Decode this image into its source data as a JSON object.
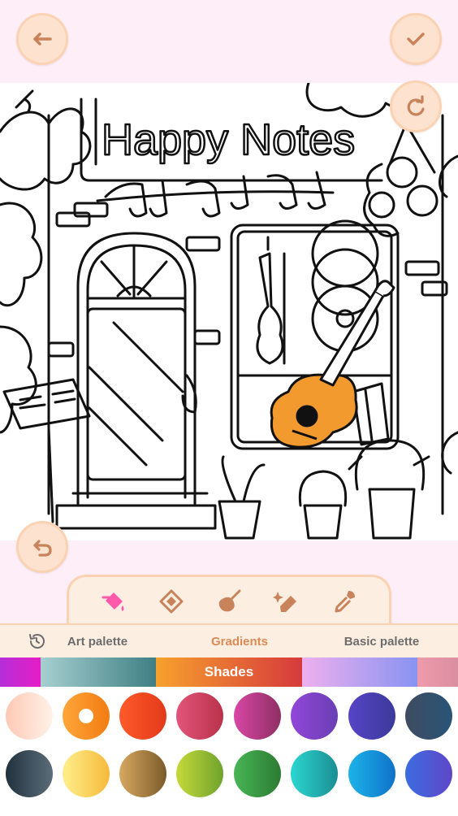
{
  "canvas_title": "Happy Notes",
  "toolbar": {
    "back_icon": "arrow-left-icon",
    "done_icon": "checkmark-icon",
    "reset_icon": "refresh-icon",
    "undo_icon": "undo-icon"
  },
  "tools": [
    {
      "name": "bucket-fill-tool",
      "icon": "paint-bucket-icon",
      "active": true
    },
    {
      "name": "pattern-fill-tool",
      "icon": "diamond-fill-icon",
      "active": false
    },
    {
      "name": "brush-tool",
      "icon": "brush-icon",
      "active": false
    },
    {
      "name": "eraser-tool",
      "icon": "magic-eraser-icon",
      "active": false
    },
    {
      "name": "eyedropper-tool",
      "icon": "eyedropper-icon",
      "active": false
    }
  ],
  "tabs": {
    "history_icon": "history-icon",
    "art": "Art palette",
    "gradients": "Gradients",
    "basic": "Basic palette",
    "active": "Gradients"
  },
  "strip": {
    "label": "Shades",
    "segments": [
      {
        "from": "#b52fd8",
        "to": "#e61dc5"
      },
      {
        "from": "#a7cfd0",
        "to": "#3e7f83"
      },
      {
        "from": "#f7a12d",
        "to": "#d63a3c"
      },
      {
        "from": "#eeb0ee",
        "to": "#8893f2"
      },
      {
        "from": "#ef9aaa",
        "to": "#d98fa0"
      }
    ]
  },
  "swatches": [
    {
      "from": "#ffc9b5",
      "to": "#fff1e8"
    },
    {
      "from": "#ffa63a",
      "to": "#f27c12",
      "selected": true
    },
    {
      "from": "#ff5a2a",
      "to": "#e23a1a"
    },
    {
      "from": "#e2557a",
      "to": "#b9324b"
    },
    {
      "from": "#d846a4",
      "to": "#8f2f63"
    },
    {
      "from": "#9146d9",
      "to": "#6a3fb4"
    },
    {
      "from": "#5644c6",
      "to": "#3b3a9b"
    },
    {
      "from": "#3e4c60",
      "to": "#2a5478"
    },
    {
      "from": "#22313e",
      "to": "#5c6d7a"
    },
    {
      "from": "#fff08c",
      "to": "#f6b93a"
    },
    {
      "from": "#d6a860",
      "to": "#7c5a2a"
    },
    {
      "from": "#c6d93a",
      "to": "#6fa32d"
    },
    {
      "from": "#48b654",
      "to": "#2c7a33"
    },
    {
      "from": "#2bd6d0",
      "to": "#1a8e93"
    },
    {
      "from": "#1cb3e8",
      "to": "#1072c9"
    },
    {
      "from": "#3c6de0",
      "to": "#6046c9"
    }
  ]
}
